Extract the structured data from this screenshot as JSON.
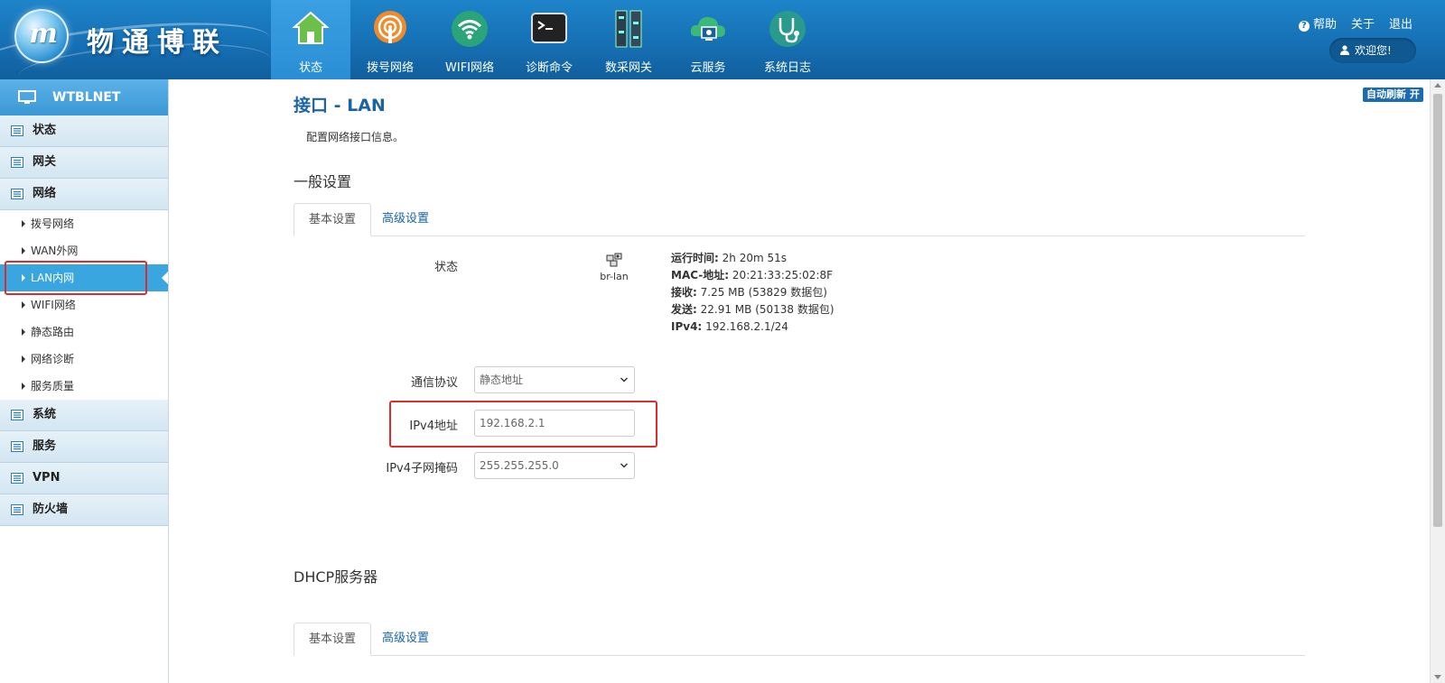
{
  "header": {
    "logo_mark": "m",
    "brand": "物通博联",
    "nav": [
      {
        "label": "状态",
        "icon": "home-icon",
        "active": true
      },
      {
        "label": "拨号网络",
        "icon": "dial-network-icon"
      },
      {
        "label": "WIFI网络",
        "icon": "wifi-icon"
      },
      {
        "label": "诊断命令",
        "icon": "terminal-icon"
      },
      {
        "label": "数采网关",
        "icon": "gateway-icon"
      },
      {
        "label": "云服务",
        "icon": "cloud-icon"
      },
      {
        "label": "系统日志",
        "icon": "stethoscope-icon"
      }
    ],
    "help": "帮助",
    "about": "关于",
    "logout": "退出",
    "welcome": "欢迎您!"
  },
  "sidebar": {
    "title": "WTBLNET",
    "groups_top": [
      "状态",
      "网关",
      "网络"
    ],
    "network_items": [
      "拨号网络",
      "WAN外网",
      "LAN内网",
      "WIFI网络",
      "静态路由",
      "网络诊断",
      "服务质量"
    ],
    "active_item": "LAN内网",
    "groups_bottom": [
      "系统",
      "服务",
      "VPN",
      "防火墙"
    ]
  },
  "main": {
    "auto_refresh": "自动刷新 开",
    "title": "接口 - LAN",
    "description": "配置网络接口信息。",
    "general_section": "一般设置",
    "tabs": {
      "basic": "基本设置",
      "advanced": "高级设置"
    },
    "status_label": "状态",
    "device": "br-lan",
    "status": {
      "uptime_label": "运行时间:",
      "uptime": "2h 20m 51s",
      "mac_label": "MAC-地址:",
      "mac": "20:21:33:25:02:8F",
      "rx_label": "接收:",
      "rx": "7.25 MB (53829 数据包)",
      "tx_label": "发送:",
      "tx": "22.91 MB (50138 数据包)",
      "ipv4_label": "IPv4:",
      "ipv4": "192.168.2.1/24"
    },
    "protocol_label": "通信协议",
    "protocol_value": "静态地址",
    "ipv4_addr_label": "IPv4地址",
    "ipv4_addr_value": "192.168.2.1",
    "netmask_label": "IPv4子网掩码",
    "netmask_value": "255.255.255.0",
    "dhcp_section": "DHCP服务器",
    "dhcp_tabs": {
      "basic": "基本设置",
      "advanced": "高级设置"
    }
  },
  "colors": {
    "header": "#1670b4",
    "accent": "#3aa6e0",
    "highlight_box": "#e02b2b",
    "title": "#1a64a6"
  }
}
